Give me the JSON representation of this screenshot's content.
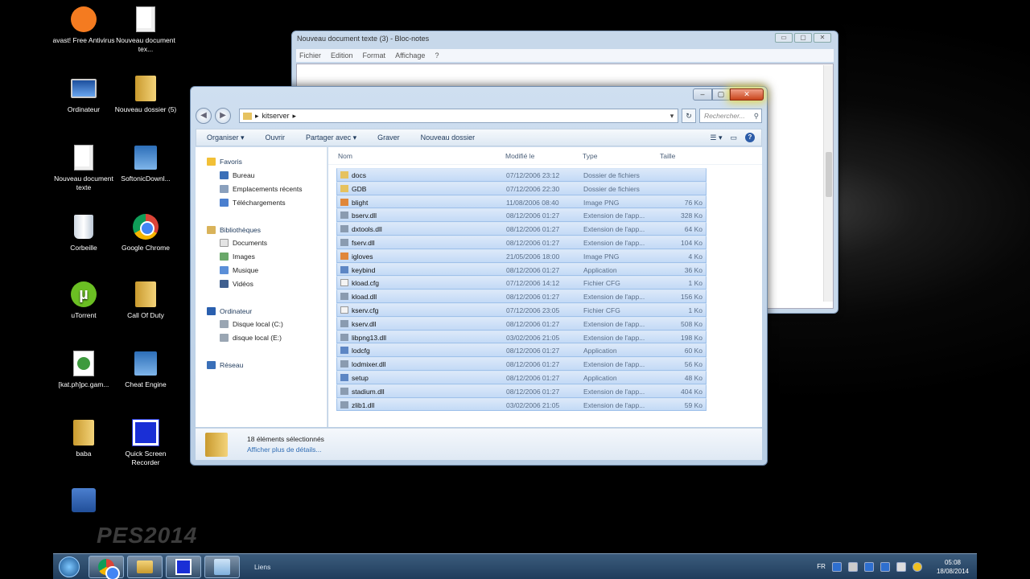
{
  "desktop": {
    "watermark": "PES2014",
    "icons": [
      {
        "label": "avast! Free Antivirus",
        "icon": "avast-icon"
      },
      {
        "label": "Nouveau document tex...",
        "icon": "text-document-icon"
      },
      {
        "label": "Ordinateur",
        "icon": "computer-icon"
      },
      {
        "label": "Nouveau dossier (5)",
        "icon": "folder-icon"
      },
      {
        "label": "Nouveau document texte",
        "icon": "text-document-icon"
      },
      {
        "label": "SoftonicDownl...",
        "icon": "installer-icon"
      },
      {
        "label": "Corbeille",
        "icon": "recycle-bin-icon"
      },
      {
        "label": "Google Chrome",
        "icon": "chrome-icon"
      },
      {
        "label": "uTorrent",
        "icon": "utorrent-icon"
      },
      {
        "label": "Call Of Duty",
        "icon": "folder-icon"
      },
      {
        "label": "[kat.ph]pc.gam...",
        "icon": "archive-icon"
      },
      {
        "label": "Cheat Engine",
        "icon": "cheat-engine-icon"
      },
      {
        "label": "baba",
        "icon": "folder-icon"
      },
      {
        "label": "Quick Screen Recorder",
        "icon": "qsr-icon"
      },
      {
        "label": "",
        "icon": "network-icon"
      }
    ]
  },
  "notepad": {
    "title": "Nouveau document texte (3) - Bloc-notes",
    "menu": [
      "Fichier",
      "Edition",
      "Format",
      "Affichage",
      "?"
    ]
  },
  "explorer": {
    "address": "kitserver",
    "search_placeholder": "Rechercher...",
    "toolbar": [
      "Organiser ▾",
      "Ouvrir",
      "Partager avec ▾",
      "Graver",
      "Nouveau dossier"
    ],
    "nav": {
      "favorites": "Favoris",
      "fav_items": [
        "Bureau",
        "Emplacements récents",
        "Téléchargements"
      ],
      "libraries": "Bibliothèques",
      "lib_items": [
        "Documents",
        "Images",
        "Musique",
        "Vidéos"
      ],
      "computer": "Ordinateur",
      "comp_items": [
        "Disque local (C:)",
        "disque local (E:)"
      ],
      "network": "Réseau"
    },
    "columns": {
      "name": "Nom",
      "modified": "Modifié le",
      "type": "Type",
      "size": "Taille"
    },
    "files": [
      {
        "name": "docs",
        "modified": "07/12/2006 23:12",
        "type": "Dossier de fichiers",
        "size": "",
        "kind": "folder"
      },
      {
        "name": "GDB",
        "modified": "07/12/2006 22:30",
        "type": "Dossier de fichiers",
        "size": "",
        "kind": "folder"
      },
      {
        "name": "blight",
        "modified": "11/08/2006 08:40",
        "type": "Image PNG",
        "size": "76 Ko",
        "kind": "image"
      },
      {
        "name": "bserv.dll",
        "modified": "08/12/2006 01:27",
        "type": "Extension de l'app...",
        "size": "328 Ko",
        "kind": "dll"
      },
      {
        "name": "dxtools.dll",
        "modified": "08/12/2006 01:27",
        "type": "Extension de l'app...",
        "size": "64 Ko",
        "kind": "dll"
      },
      {
        "name": "fserv.dll",
        "modified": "08/12/2006 01:27",
        "type": "Extension de l'app...",
        "size": "104 Ko",
        "kind": "dll"
      },
      {
        "name": "igloves",
        "modified": "21/05/2006 18:00",
        "type": "Image PNG",
        "size": "4 Ko",
        "kind": "image"
      },
      {
        "name": "keybind",
        "modified": "08/12/2006 01:27",
        "type": "Application",
        "size": "36 Ko",
        "kind": "app"
      },
      {
        "name": "kload.cfg",
        "modified": "07/12/2006 14:12",
        "type": "Fichier CFG",
        "size": "1 Ko",
        "kind": "cfg"
      },
      {
        "name": "kload.dll",
        "modified": "08/12/2006 01:27",
        "type": "Extension de l'app...",
        "size": "156 Ko",
        "kind": "dll"
      },
      {
        "name": "kserv.cfg",
        "modified": "07/12/2006 23:05",
        "type": "Fichier CFG",
        "size": "1 Ko",
        "kind": "cfg"
      },
      {
        "name": "kserv.dll",
        "modified": "08/12/2006 01:27",
        "type": "Extension de l'app...",
        "size": "508 Ko",
        "kind": "dll"
      },
      {
        "name": "libpng13.dll",
        "modified": "03/02/2006 21:05",
        "type": "Extension de l'app...",
        "size": "198 Ko",
        "kind": "dll"
      },
      {
        "name": "lodcfg",
        "modified": "08/12/2006 01:27",
        "type": "Application",
        "size": "60 Ko",
        "kind": "app"
      },
      {
        "name": "lodmixer.dll",
        "modified": "08/12/2006 01:27",
        "type": "Extension de l'app...",
        "size": "56 Ko",
        "kind": "dll"
      },
      {
        "name": "setup",
        "modified": "08/12/2006 01:27",
        "type": "Application",
        "size": "48 Ko",
        "kind": "app"
      },
      {
        "name": "stadium.dll",
        "modified": "08/12/2006 01:27",
        "type": "Extension de l'app...",
        "size": "404 Ko",
        "kind": "dll"
      },
      {
        "name": "zlib1.dll",
        "modified": "03/02/2006 21:05",
        "type": "Extension de l'app...",
        "size": "59 Ko",
        "kind": "dll"
      }
    ],
    "status": {
      "count": "18 éléments sélectionnés",
      "details": "Afficher plus de détails..."
    }
  },
  "taskbar": {
    "label": "Liens",
    "lang": "FR",
    "time": "05:08",
    "date": "18/08/2014"
  }
}
